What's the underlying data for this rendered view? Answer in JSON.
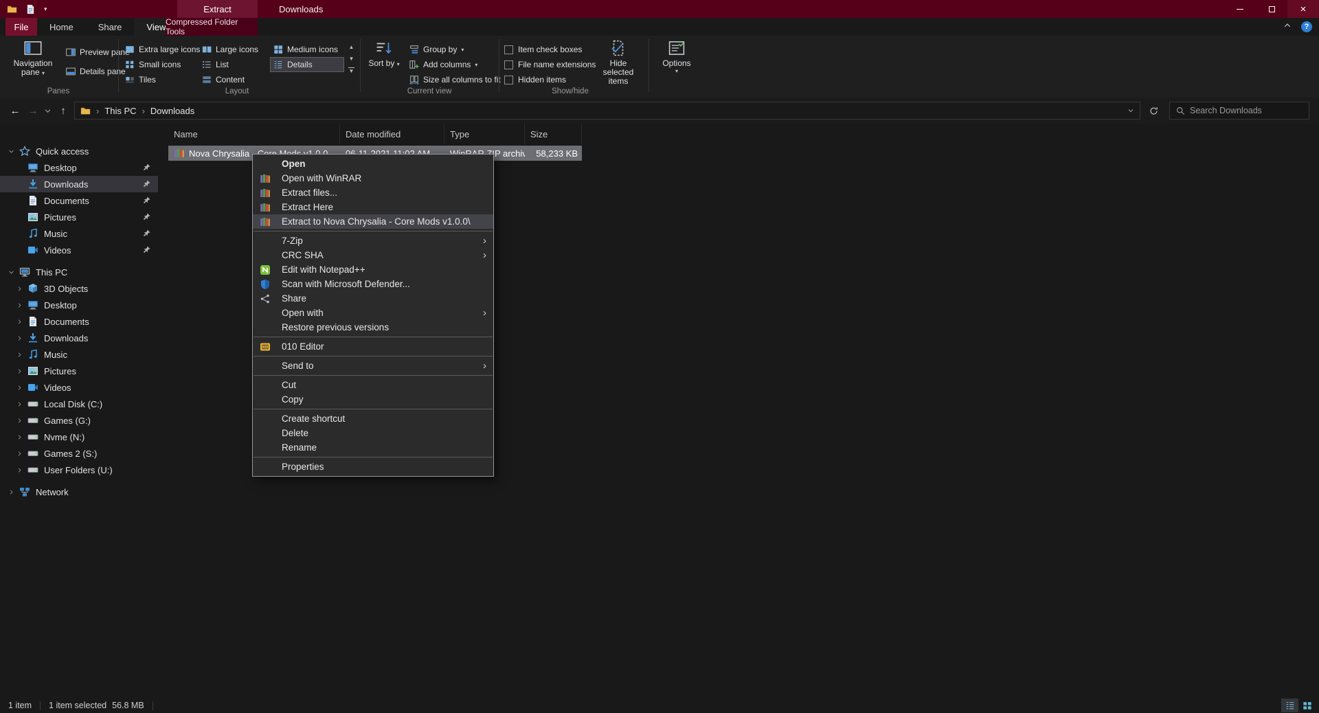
{
  "titlebar": {
    "contextual_tab": "Extract",
    "title": "Downloads"
  },
  "tabs": {
    "file": "File",
    "home": "Home",
    "share": "Share",
    "view": "View",
    "contextual": "Compressed Folder Tools"
  },
  "ribbon": {
    "panes": {
      "label": "Panes",
      "navigation": "Navigation pane",
      "preview": "Preview pane",
      "details": "Details pane"
    },
    "layout": {
      "label": "Layout",
      "options": [
        "Extra large icons",
        "Large icons",
        "Small icons",
        "List",
        "Tiles",
        "Content",
        "Medium icons",
        "Details"
      ],
      "selected": "Details"
    },
    "current_view": {
      "label": "Current view",
      "sort_by": "Sort by",
      "group_by": "Group by",
      "add_columns": "Add columns",
      "size_all_columns": "Size all columns to fit"
    },
    "show_hide": {
      "label": "Show/hide",
      "item_check_boxes": "Item check boxes",
      "file_name_extensions": "File name extensions",
      "hidden_items": "Hidden items",
      "hide_selected_items": "Hide selected items"
    },
    "options": {
      "label": "Options"
    }
  },
  "address_bar": {
    "crumb_root": "This PC",
    "crumb_current": "Downloads",
    "search_placeholder": "Search Downloads"
  },
  "sidebar": {
    "quick_access": {
      "label": "Quick access",
      "items": [
        "Desktop",
        "Downloads",
        "Documents",
        "Pictures",
        "Music",
        "Videos"
      ],
      "selected": "Downloads"
    },
    "this_pc": {
      "label": "This PC",
      "items": [
        "3D Objects",
        "Desktop",
        "Documents",
        "Downloads",
        "Music",
        "Pictures",
        "Videos",
        "Local Disk (C:)",
        "Games (G:)",
        "Nvme (N:)",
        "Games 2 (S:)",
        "User Folders (U:)"
      ]
    },
    "network": {
      "label": "Network"
    }
  },
  "file_list": {
    "columns": [
      "Name",
      "Date modified",
      "Type",
      "Size"
    ],
    "row": {
      "name": "Nova Chrysalia - Core Mods v1.0.0",
      "date_modified": "06-11-2021 11:02 AM",
      "type": "WinRAR ZIP archive",
      "size": "58,233 KB",
      "selected": true
    }
  },
  "context_menu": {
    "items": [
      {
        "label": "Open",
        "bold": true
      },
      {
        "label": "Open with WinRAR",
        "icon": "winrar-icon"
      },
      {
        "label": "Extract files...",
        "icon": "winrar-icon"
      },
      {
        "label": "Extract Here",
        "icon": "winrar-icon"
      },
      {
        "label": "Extract to Nova Chrysalia - Core Mods v1.0.0\\",
        "icon": "winrar-icon",
        "highlighted": true
      },
      {
        "separator": true
      },
      {
        "label": "7-Zip",
        "submenu": true
      },
      {
        "label": "CRC SHA",
        "submenu": true
      },
      {
        "label": "Edit with Notepad++",
        "icon": "notepad-plus-plus-icon"
      },
      {
        "label": "Scan with Microsoft Defender...",
        "icon": "defender-icon"
      },
      {
        "label": "Share",
        "icon": "share-icon"
      },
      {
        "label": "Open with",
        "submenu": true
      },
      {
        "label": "Restore previous versions"
      },
      {
        "separator": true
      },
      {
        "label": "010 Editor",
        "icon": "010-editor-icon"
      },
      {
        "separator": true
      },
      {
        "label": "Send to",
        "submenu": true
      },
      {
        "separator": true
      },
      {
        "label": "Cut"
      },
      {
        "label": "Copy"
      },
      {
        "separator": true
      },
      {
        "label": "Create shortcut"
      },
      {
        "label": "Delete"
      },
      {
        "label": "Rename"
      },
      {
        "separator": true
      },
      {
        "label": "Properties"
      }
    ]
  },
  "status_bar": {
    "items_count": "1 item",
    "selection": "1 item selected",
    "selection_size": "56.8 MB"
  },
  "colors": {
    "titlebar": "#570019",
    "file_tab": "#75102c",
    "contextual_tab_bg": "#4b0019",
    "ribbon_bg": "#1f1f1f",
    "selection_gray": "#6d6d74",
    "menu_bg": "#2b2b2b",
    "menu_highlight": "#43434a"
  }
}
